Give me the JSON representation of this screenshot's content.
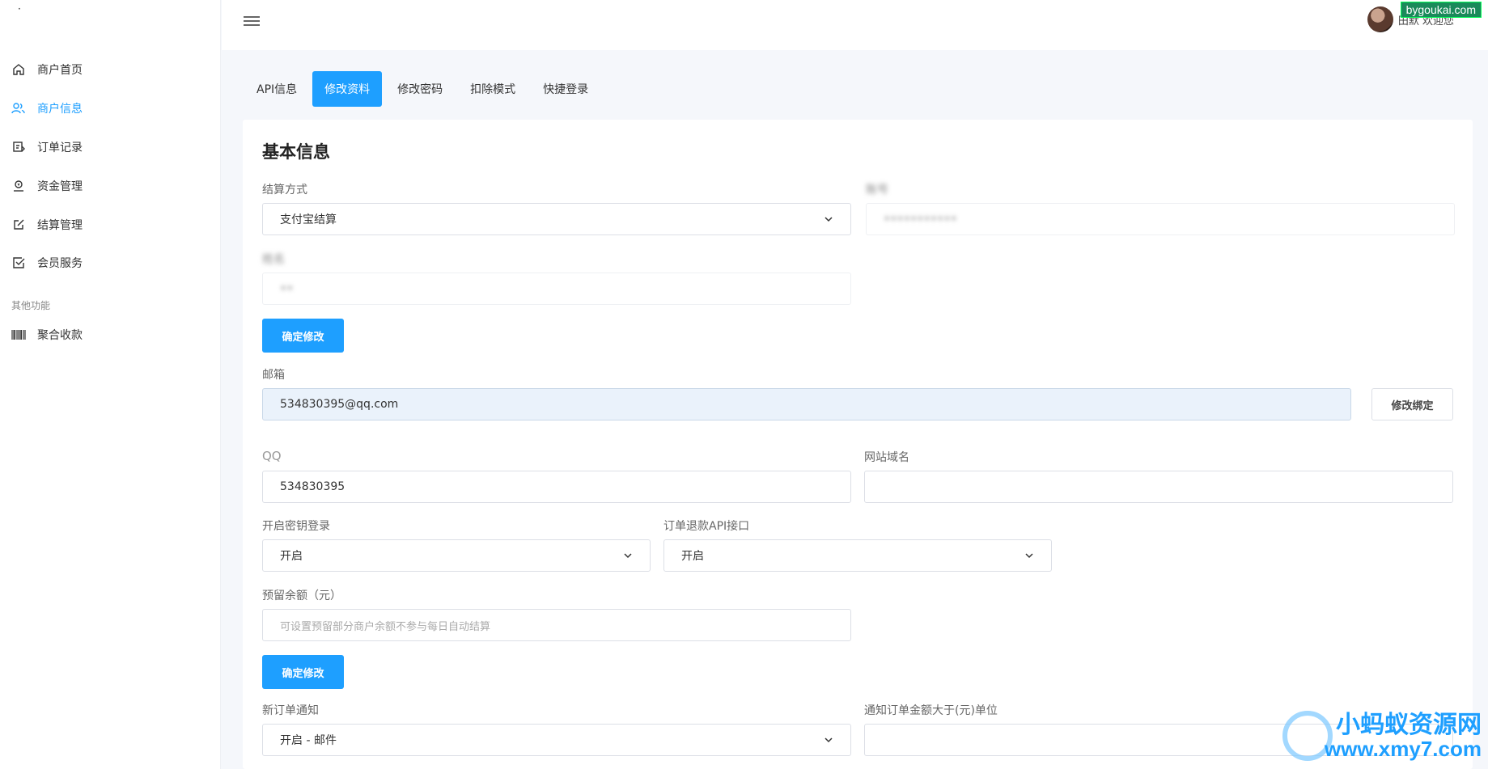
{
  "sidebar": {
    "brand_mark": "·",
    "items": [
      {
        "label": "商户首页",
        "icon": "home-icon"
      },
      {
        "label": "商户信息",
        "icon": "users-icon"
      },
      {
        "label": "订单记录",
        "icon": "order-icon"
      },
      {
        "label": "资金管理",
        "icon": "wallet-icon"
      },
      {
        "label": "结算管理",
        "icon": "edit-icon"
      },
      {
        "label": "会员服务",
        "icon": "checkbox-icon"
      }
    ],
    "section_label": "其他功能",
    "other_items": [
      {
        "label": "聚合收款",
        "icon": "barcode-icon"
      }
    ]
  },
  "topbar": {
    "username": "田默 欢迎您",
    "badge": "bygoukai.com"
  },
  "tabs": [
    {
      "label": "API信息"
    },
    {
      "label": "修改资料"
    },
    {
      "label": "修改密码"
    },
    {
      "label": "扣除模式"
    },
    {
      "label": "快捷登录"
    }
  ],
  "card": {
    "title": "基本信息",
    "settle_method": {
      "label": "结算方式",
      "value": "支付宝结算"
    },
    "account_field": {
      "label": "账号",
      "value": "•••••••••••"
    },
    "name_field": {
      "label": "姓名",
      "value": "••"
    },
    "confirm_label": "确定修改",
    "email": {
      "label": "邮箱",
      "value": "534830395@qq.com",
      "button": "修改绑定"
    },
    "qq": {
      "label": "QQ",
      "value": "534830395"
    },
    "domain": {
      "label": "网站域名",
      "value": ""
    },
    "key_login": {
      "label": "开启密钥登录",
      "value": "开启"
    },
    "refund_api": {
      "label": "订单退款API接口",
      "value": "开启"
    },
    "reserve": {
      "label": "预留余额（元）",
      "placeholder": "可设置预留部分商户余额不参与每日自动结算"
    },
    "confirm_label_2": "确定修改",
    "new_order_notify": {
      "label": "新订单通知",
      "value": "开启 - 邮件"
    },
    "notify_amount": {
      "label": "通知订单金额大于(元)单位",
      "value": ""
    }
  },
  "watermark": {
    "brand": "小蚂蚁资源网",
    "url": "www.xmy7.com"
  }
}
